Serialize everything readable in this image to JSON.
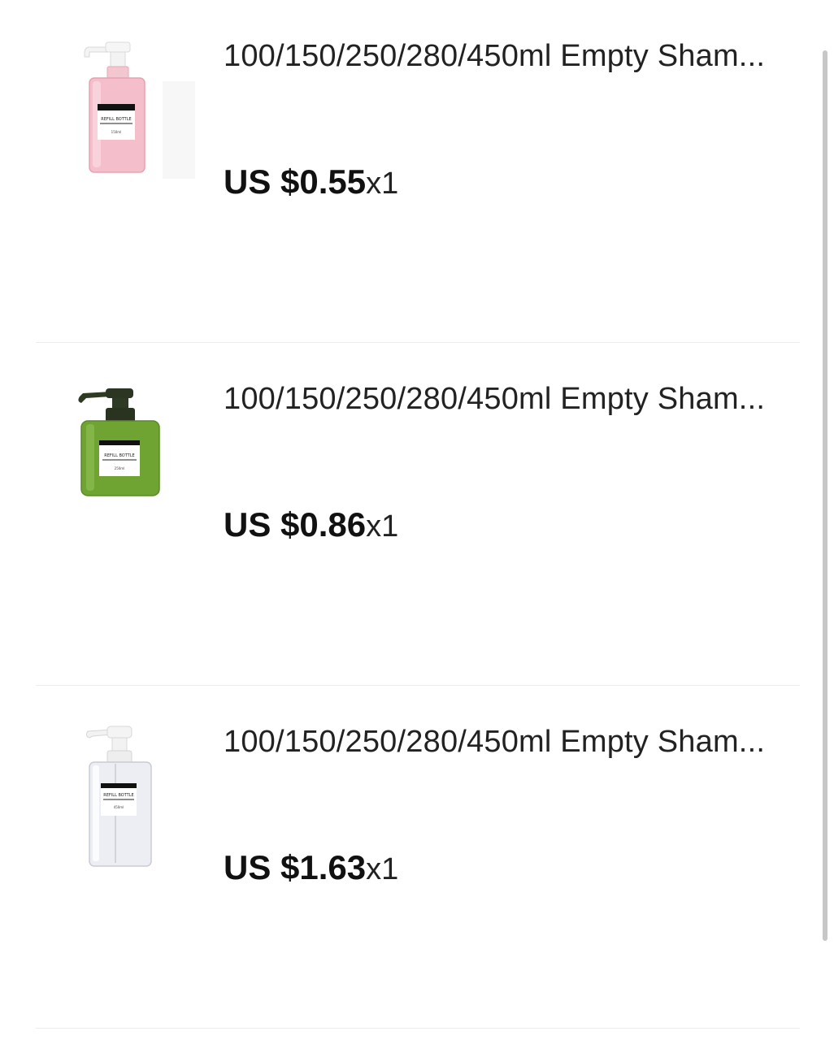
{
  "cart": {
    "items": [
      {
        "title": "100/150/250/280/450ml Empty Sham...",
        "price": "US $0.55",
        "quantity": "x1",
        "image_icon": "pink-pump-bottle-icon",
        "label_text": "REFILL BOTTLE",
        "label_volume": "150ml",
        "color": "#f2b8c4"
      },
      {
        "title": "100/150/250/280/450ml Empty Sham...",
        "price": "US $0.86",
        "quantity": "x1",
        "image_icon": "green-pump-bottle-icon",
        "label_text": "REFILL BOTTLE",
        "label_volume": "250ml",
        "color": "#6fa332"
      },
      {
        "title": "100/150/250/280/450ml Empty Sham...",
        "price": "US $1.63",
        "quantity": "x1",
        "image_icon": "clear-pump-bottle-icon",
        "label_text": "REFILL BOTTLE",
        "label_volume": "450ml",
        "color": "#e4e6ec"
      }
    ]
  }
}
